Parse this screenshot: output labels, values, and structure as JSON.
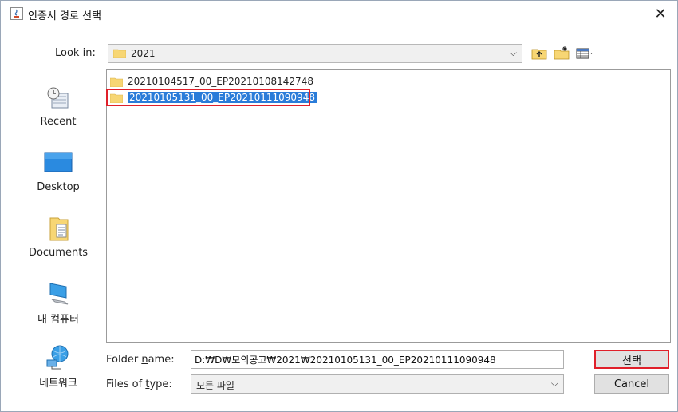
{
  "window": {
    "title": "인증서 경로 선택",
    "close_label": "✕"
  },
  "lookin": {
    "label_pre": "Look ",
    "label_ul": "i",
    "label_post": "n:",
    "value": "2021",
    "arrow": "⌵"
  },
  "sidebar": {
    "items": [
      {
        "label": "Recent"
      },
      {
        "label": "Desktop"
      },
      {
        "label": "Documents"
      },
      {
        "label": "내 컴퓨터"
      },
      {
        "label": "네트워크"
      }
    ]
  },
  "files": [
    {
      "name": "20210104517_00_EP20210108142748",
      "selected": false
    },
    {
      "name": "20210105131_00_EP20210111090948",
      "selected": true
    }
  ],
  "filename": {
    "label_pre": "Folder ",
    "label_ul": "n",
    "label_post": "ame:",
    "value": "D:₩D₩모의공고₩2021₩20210105131_00_EP20210111090948"
  },
  "filetype": {
    "label_pre": "Files of ",
    "label_ul": "t",
    "label_post": "ype:",
    "value": "모든 파일",
    "arrow": "⌵"
  },
  "buttons": {
    "select": "선택",
    "cancel": "Cancel"
  },
  "colors": {
    "selection": "#2a7cd9",
    "highlight_border": "#e0202a",
    "folder": "#f7d674"
  }
}
